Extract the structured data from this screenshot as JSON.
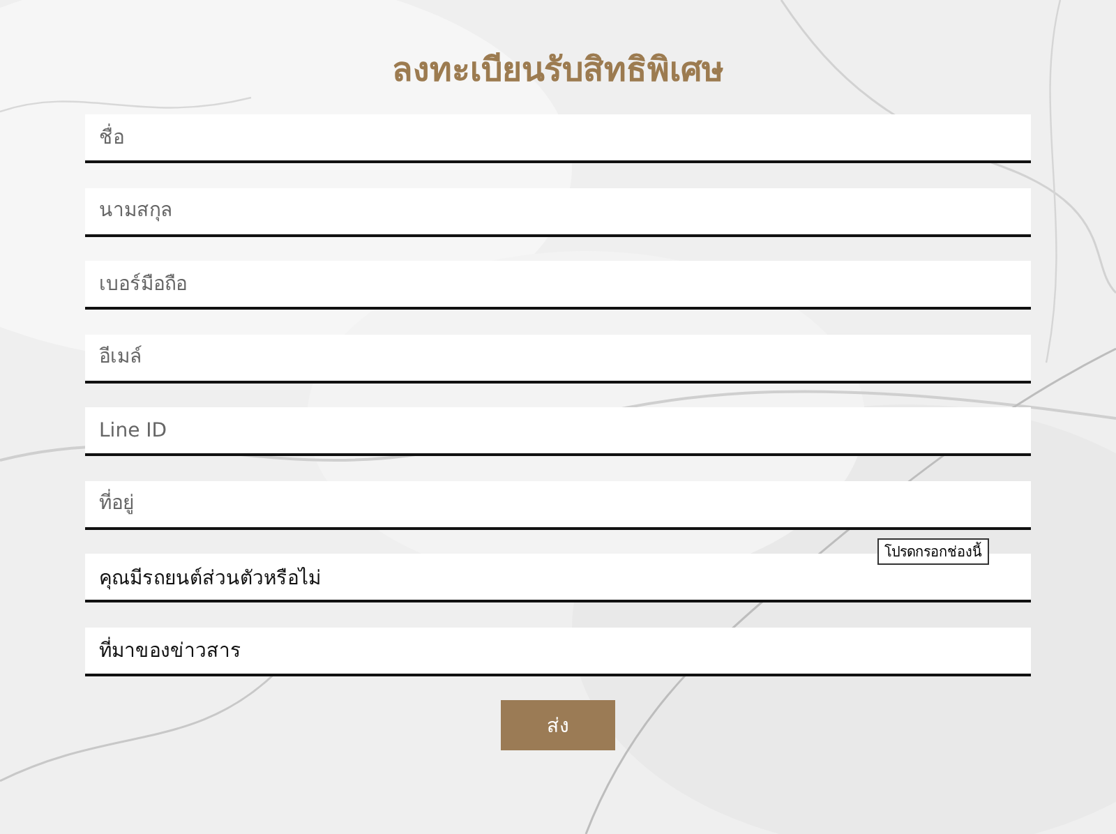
{
  "title": "ลงทะเบียนรับสิทธิพิเศษ",
  "fields": [
    {
      "kind": "text",
      "placeholder": "ชื่อ"
    },
    {
      "kind": "text",
      "placeholder": "นามสกุล"
    },
    {
      "kind": "text",
      "placeholder": "เบอร์มือถือ"
    },
    {
      "kind": "text",
      "placeholder": "อีเมล์"
    },
    {
      "kind": "text",
      "placeholder": "Line ID"
    },
    {
      "kind": "text",
      "placeholder": "ที่อยู่"
    },
    {
      "kind": "select",
      "value": "คุณมีรถยนต์ส่วนตัวหรือไม่",
      "tooltip": "โปรดกรอกช่องนี้"
    },
    {
      "kind": "select",
      "value": "ที่มาของข่าวสาร"
    }
  ],
  "submit": "ส่ง"
}
